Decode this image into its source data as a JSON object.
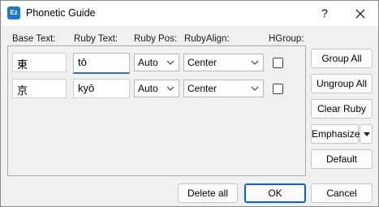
{
  "window": {
    "title": "Phonetic Guide",
    "icon_text": "Ez",
    "help_label": "?"
  },
  "headers": {
    "base_text": "Base Text:",
    "ruby_text": "Ruby Text:",
    "ruby_pos": "Ruby Pos:",
    "ruby_align": "RubyAlign:",
    "hgroup": "HGroup:"
  },
  "rows": [
    {
      "base": "東",
      "ruby": "tō",
      "pos": "Auto",
      "align": "Center",
      "hgroup": false
    },
    {
      "base": "京",
      "ruby": "kyō",
      "pos": "Auto",
      "align": "Center",
      "hgroup": false
    }
  ],
  "side_buttons": {
    "group_all": "Group All",
    "ungroup_all": "Ungroup All",
    "clear_ruby": "Clear Ruby",
    "emphasize": "Emphasize",
    "default": "Default"
  },
  "footer": {
    "delete_all": "Delete all",
    "ok": "OK",
    "cancel": "Cancel"
  },
  "colors": {
    "focus_underline": "#2f6fc0",
    "ok_border": "#0067c0",
    "app_icon": "#1d78c8"
  }
}
